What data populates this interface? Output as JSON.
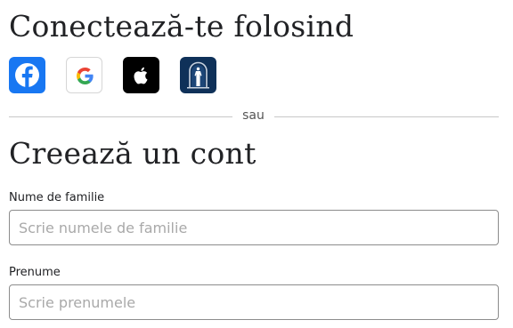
{
  "login_section": {
    "title": "Conectează-te folosind",
    "providers": [
      {
        "icon": "facebook-icon",
        "color": "#1877f2"
      },
      {
        "icon": "google-icon",
        "color": "#ffffff"
      },
      {
        "icon": "apple-icon",
        "color": "#000000"
      },
      {
        "icon": "church-temple-icon",
        "color": "#0f3159"
      }
    ]
  },
  "divider": {
    "text": "sau"
  },
  "create_section": {
    "title": "Creează un cont",
    "last_name": {
      "label": "Nume de familie",
      "placeholder": "Scrie numele de familie",
      "value": ""
    },
    "first_name": {
      "label": "Prenume",
      "placeholder": "Scrie prenumele",
      "value": ""
    }
  },
  "colors": {
    "text": "#212225",
    "divider": "#c8c8c8",
    "input_border": "#8c8c8c",
    "placeholder": "#a9a9a9"
  }
}
